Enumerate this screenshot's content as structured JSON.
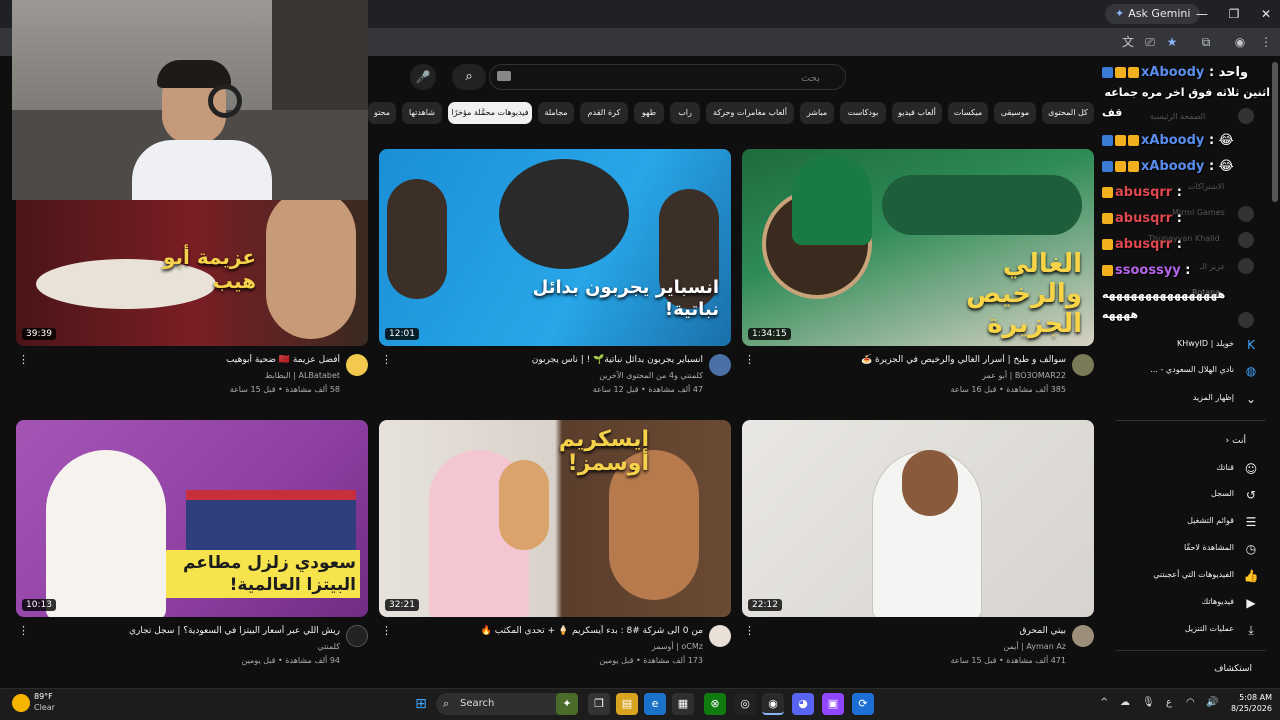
{
  "browser": {
    "ask_gemini": "Ask Gemini"
  },
  "search": {
    "placeholder": "بحث"
  },
  "chips": [
    "كل المحتوى",
    "موسيقى",
    "ميكسات",
    "ألعاب فيديو",
    "بودكاست",
    "مباشر",
    "ألعاب مغامرات وحركة",
    "راب",
    "طهو",
    "كرة القدم",
    "مجاملة",
    "فيديوهات محمَّلة مؤخرًا",
    "شاهدتها",
    "محتو"
  ],
  "videos": [
    {
      "title": "سوالف و طبخ | أسرار الغالي والرخيص في الجزيرة 🍝",
      "channel": "BO3OMAR22 | أبو عمر",
      "stats": "385 ألف مشاهدة • قبل 16 ساعة",
      "duration": "1:34:15",
      "overlay": "الغالي والرخيص الجزيرة"
    },
    {
      "title": "انسباير يجربون بدائل نباتية🌱 ! | ناس يجربون",
      "channel": "كلمنتي و4 من المحتوى الآخرين",
      "stats": "47 ألف مشاهدة • قبل 12 ساعة",
      "duration": "12:01",
      "overlay": "انسباير يجربون بدائل نباتية!"
    },
    {
      "title": "أفضل عزيمة 🇲🇦 ضحية أبوهيب",
      "channel": "ALBatabet | البطابط",
      "stats": "58 ألف مشاهدة • قبل 15 ساعة",
      "duration": "39:39",
      "overlay": "عزيمة أبو هيب"
    },
    {
      "title": "بيتي المحرق",
      "channel": "Ayman Az | أيمن",
      "stats": "471 ألف مشاهدة • قبل 15 ساعة",
      "duration": "22:12",
      "overlay": ""
    },
    {
      "title": "من 0 الى شركة #8 : بدء آيسكريم 🍦 + تحدي المكتب 🔥",
      "channel": "oCMz | أوسمز",
      "stats": "173 ألف مشاهدة • قبل يومين",
      "duration": "32:21",
      "overlay": "ايسكريم أوسمز!"
    },
    {
      "title": "ريش اللي عبر أسعار البيتزا في السعودية؟ | سجل تجاري",
      "channel": "كلمنتي",
      "stats": "94 ألف مشاهدة • قبل يومين",
      "duration": "10:13",
      "overlay": "سعودي زلزل مطاعم البيتزا العالمية!"
    }
  ],
  "right_panel": {
    "subs": [
      {
        "label": "خويلد | KHwyID"
      },
      {
        "label": "نادي الهلال السعودي - ..."
      }
    ],
    "show_more": "إظهار المزيد",
    "you_heading": "أنت",
    "you_items": [
      {
        "label": "قناتك",
        "icon": "person-icon"
      },
      {
        "label": "السجل",
        "icon": "history-icon"
      },
      {
        "label": "قوائم التشغيل",
        "icon": "playlist-icon"
      },
      {
        "label": "المشاهدة لاحقًا",
        "icon": "clock-icon"
      },
      {
        "label": "الفيديوهات التي أعجبتني",
        "icon": "thumbs-up-icon"
      },
      {
        "label": "فيديوهاتك",
        "icon": "video-icon"
      },
      {
        "label": "عمليات التنزيل",
        "icon": "download-icon"
      }
    ],
    "explore": "استكشاف"
  },
  "chat": [
    {
      "user": "xAboody",
      "text": ": واحد",
      "color": "blue"
    },
    {
      "user": "",
      "text": "اثنين ثلاثه فوق اخر مره جماعه",
      "color": "white"
    },
    {
      "user": "",
      "text": "قف",
      "color": "white"
    },
    {
      "user": "xAboody",
      "text": ": 😂",
      "color": "blue"
    },
    {
      "user": "xAboody",
      "text": ": 😂",
      "color": "blue"
    },
    {
      "user": "abusqrr",
      "text": ":",
      "color": "red"
    },
    {
      "user": "abusqrr",
      "text": ":",
      "color": "red"
    },
    {
      "user": "abusqrr",
      "text": ":",
      "color": "red"
    },
    {
      "user": "ssoossyy",
      "text": ":",
      "color": "purple"
    },
    {
      "user": "",
      "text": "ههههههههههههههههه",
      "color": "white"
    },
    {
      "user": "",
      "text": "ههههه",
      "color": "white"
    }
  ],
  "bg_labels": [
    "الصفحة الرئيسية",
    "الاشتراكات",
    "Mirmi Games",
    "Thunayyan Khalid",
    "عزيز الـ",
    "Rotana"
  ],
  "taskbar": {
    "temp": "89°F",
    "condition": "Clear",
    "search": "Search",
    "time": "5:08 AM",
    "date": "8/25/2026"
  }
}
